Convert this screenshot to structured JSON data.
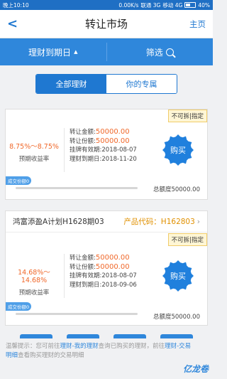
{
  "status_bar": {
    "time": "晚上10:10",
    "speed": "0.00K/s",
    "carrier1": "联通 3G",
    "carrier2": "移动 4G",
    "battery": "40%"
  },
  "nav": {
    "back_icon": "chevron-left-icon",
    "title": "转让市场",
    "home_label": "主页"
  },
  "filter": {
    "sort_label": "理财到期日",
    "filter_label": "筛选"
  },
  "segment": {
    "tabs": [
      {
        "label": "全部理财",
        "active": true
      },
      {
        "label": "你的专属",
        "active": false
      }
    ]
  },
  "products": [
    {
      "name": "",
      "code_label": "",
      "tag": "不可拆|指定",
      "rate": "8.75%～8.75%",
      "rate_label": "预期收益率",
      "transfer_amount_label": "转让金额:",
      "transfer_amount": "50000.00",
      "transfer_share_label": "转让份额:",
      "transfer_share": "50000.00",
      "listing_label": "挂牌有效期:",
      "listing_date": "2018-08-07",
      "maturity_label": "理财到期日:",
      "maturity_date": "2018-11-20",
      "buy_label": "购买",
      "progress_label": "成交份额0",
      "progress": 0,
      "total": "总额度50000.00"
    },
    {
      "name": "鸿富添盈A计划H1628期03",
      "code_label": "产品代码：H162803",
      "tag": "不可拆|指定",
      "rate": "14.68%～14.68%",
      "rate_label": "预期收益率",
      "transfer_amount_label": "转让金额:",
      "transfer_amount": "50000.00",
      "transfer_share_label": "转让份额:",
      "transfer_share": "50000.00",
      "listing_label": "挂牌有效期:",
      "listing_date": "2018-08-07",
      "maturity_label": "理财到期日:",
      "maturity_date": "2018-09-06",
      "buy_label": "购买",
      "progress_label": "成交份额0",
      "progress": 0,
      "total": "总额度50000.00"
    }
  ],
  "tips": {
    "prefix": "温馨提示：您可前往",
    "link1": "理财-我的理财",
    "middle": "查询已购买的理财，前往",
    "link2": "理财-交易明细",
    "suffix": "查看购买理财的交易明细"
  },
  "brand": "亿龙卷"
}
